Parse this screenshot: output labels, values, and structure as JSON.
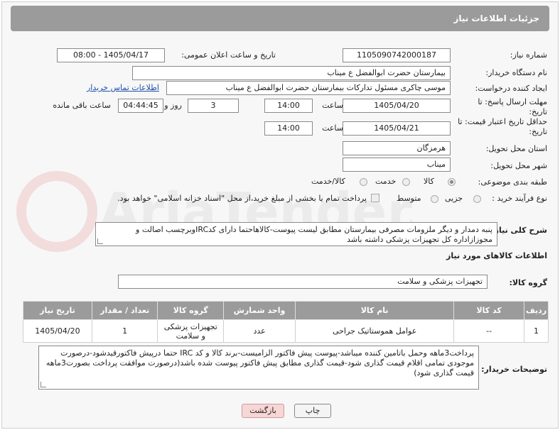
{
  "header": {
    "title": "جزئیات اطلاعات نیاز"
  },
  "fields": {
    "need_number_label": "شماره نیاز:",
    "need_number": "1105090742000187",
    "announce_label": "تاریخ و ساعت اعلان عمومی:",
    "announce_value": "1405/04/17 - 08:00",
    "buyer_org_label": "نام دستگاه خریدار:",
    "buyer_org": "بیمارستان حضرت ابوالفضل ع  میناب",
    "requester_label": "ایجاد کننده درخواست:",
    "requester": "موسی چاکری مسئول تدارکات بیمارستان حضرت ابوالفضل ع  میناب",
    "contact_link": "اطلاعات تماس خریدار",
    "deadline_label": "مهلت ارسال پاسخ: تا تاریخ:",
    "deadline_date": "1405/04/20",
    "time_label": "ساعت",
    "deadline_time": "14:00",
    "days_value": "3",
    "days_label": "روز و",
    "remaining_time": "04:44:45",
    "remaining_label": "ساعت باقی مانده",
    "validity_label": "حداقل تاریخ اعتبار قیمت: تا تاریخ:",
    "validity_date": "1405/04/21",
    "validity_time": "14:00",
    "province_label": "استان محل تحویل:",
    "province": "هرمزگان",
    "city_label": "شهر محل تحویل:",
    "city": "میناب",
    "category_label": "طبقه بندی موضوعی:",
    "category_options": [
      "کالا",
      "خدمت",
      "کالا/خدمت"
    ],
    "process_label": "نوع فرآیند خرید :",
    "process_options": [
      "جزیی",
      "متوسط"
    ],
    "payment_note": "پرداخت تمام یا بخشی از مبلغ خرید،از محل \"اسناد خزانه اسلامی\" خواهد بود."
  },
  "description": {
    "label": "شرح کلی نیاز:",
    "text": "پنبه دمدار و دیگر ملزومات مصرفی بیمارستان مطابق لیست پیوست-کالاهاحتما دارای کدIRCوبرچسب اصالت و مجوزازاداره کل تجهیزات پزشکی داشته باشد"
  },
  "goods_info": {
    "title": "اطلاعات کالاهای مورد نیاز",
    "group_label": "گروه کالا:",
    "group_value": "تجهیزات پزشکی و سلامت"
  },
  "table": {
    "headers": [
      "ردیف",
      "کد کالا",
      "نام کالا",
      "واحد شمارش",
      "گروه کالا",
      "تعداد / مقدار",
      "تاریخ نیاز"
    ],
    "rows": [
      [
        "1",
        "--",
        "عوامل هموستاتیک جراحی",
        "عدد",
        "تجهیزات پزشکی و سلامت",
        "1",
        "1405/04/20"
      ]
    ]
  },
  "buyer_notes": {
    "label": "توضیحات خریدار:",
    "text": "پرداخت3ماهه وحمل باتامین کننده میباشد-پیوست پیش فاکتور الزامیست-برند کالا و کد IRC حتما درپیش فاکتورقیدشود-درصورت موجودی تمامی اقلام قیمت گذاری شود-قیمت گذاری مطابق پیش فاکتور پیوست شده باشد(درصورت موافقت پرداخت بصورت3ماهه قیمت گذاری شود)"
  },
  "buttons": {
    "print": "چاپ",
    "back": "بازگشت"
  },
  "watermark": {
    "text": "AriaTender.net"
  },
  "colors": {
    "header_bg": "#9b9b9b",
    "link": "#1f4fa8",
    "back_button": "#f7d6d6"
  }
}
